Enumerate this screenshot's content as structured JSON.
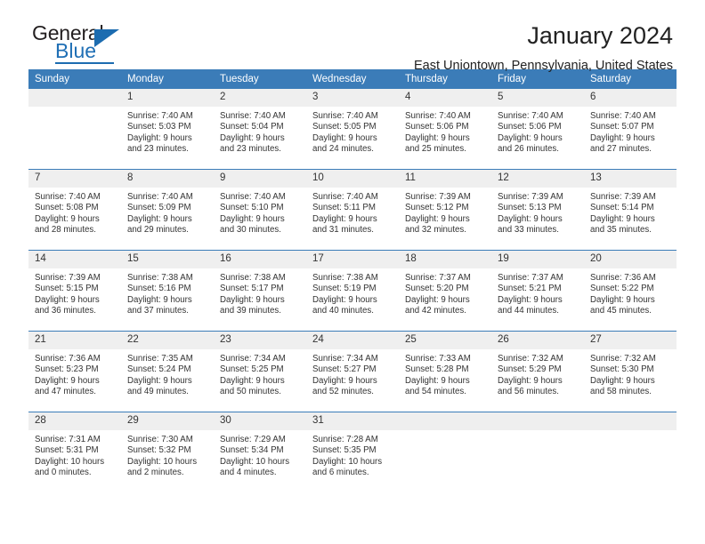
{
  "brand": {
    "name_part1": "General",
    "name_part2": "Blue",
    "accent_color": "#1c6cb0"
  },
  "header": {
    "title": "January 2024",
    "location": "East Uniontown, Pennsylvania, United States"
  },
  "calendar": {
    "header_bg": "#3b7cb8",
    "daynum_bg": "#efefef",
    "weekdays": [
      "Sunday",
      "Monday",
      "Tuesday",
      "Wednesday",
      "Thursday",
      "Friday",
      "Saturday"
    ],
    "weeks": [
      [
        {
          "day": "",
          "sunrise": "",
          "sunset": "",
          "daylight_line1": "",
          "daylight_line2": ""
        },
        {
          "day": "1",
          "sunrise": "Sunrise: 7:40 AM",
          "sunset": "Sunset: 5:03 PM",
          "daylight_line1": "Daylight: 9 hours",
          "daylight_line2": "and 23 minutes."
        },
        {
          "day": "2",
          "sunrise": "Sunrise: 7:40 AM",
          "sunset": "Sunset: 5:04 PM",
          "daylight_line1": "Daylight: 9 hours",
          "daylight_line2": "and 23 minutes."
        },
        {
          "day": "3",
          "sunrise": "Sunrise: 7:40 AM",
          "sunset": "Sunset: 5:05 PM",
          "daylight_line1": "Daylight: 9 hours",
          "daylight_line2": "and 24 minutes."
        },
        {
          "day": "4",
          "sunrise": "Sunrise: 7:40 AM",
          "sunset": "Sunset: 5:06 PM",
          "daylight_line1": "Daylight: 9 hours",
          "daylight_line2": "and 25 minutes."
        },
        {
          "day": "5",
          "sunrise": "Sunrise: 7:40 AM",
          "sunset": "Sunset: 5:06 PM",
          "daylight_line1": "Daylight: 9 hours",
          "daylight_line2": "and 26 minutes."
        },
        {
          "day": "6",
          "sunrise": "Sunrise: 7:40 AM",
          "sunset": "Sunset: 5:07 PM",
          "daylight_line1": "Daylight: 9 hours",
          "daylight_line2": "and 27 minutes."
        }
      ],
      [
        {
          "day": "7",
          "sunrise": "Sunrise: 7:40 AM",
          "sunset": "Sunset: 5:08 PM",
          "daylight_line1": "Daylight: 9 hours",
          "daylight_line2": "and 28 minutes."
        },
        {
          "day": "8",
          "sunrise": "Sunrise: 7:40 AM",
          "sunset": "Sunset: 5:09 PM",
          "daylight_line1": "Daylight: 9 hours",
          "daylight_line2": "and 29 minutes."
        },
        {
          "day": "9",
          "sunrise": "Sunrise: 7:40 AM",
          "sunset": "Sunset: 5:10 PM",
          "daylight_line1": "Daylight: 9 hours",
          "daylight_line2": "and 30 minutes."
        },
        {
          "day": "10",
          "sunrise": "Sunrise: 7:40 AM",
          "sunset": "Sunset: 5:11 PM",
          "daylight_line1": "Daylight: 9 hours",
          "daylight_line2": "and 31 minutes."
        },
        {
          "day": "11",
          "sunrise": "Sunrise: 7:39 AM",
          "sunset": "Sunset: 5:12 PM",
          "daylight_line1": "Daylight: 9 hours",
          "daylight_line2": "and 32 minutes."
        },
        {
          "day": "12",
          "sunrise": "Sunrise: 7:39 AM",
          "sunset": "Sunset: 5:13 PM",
          "daylight_line1": "Daylight: 9 hours",
          "daylight_line2": "and 33 minutes."
        },
        {
          "day": "13",
          "sunrise": "Sunrise: 7:39 AM",
          "sunset": "Sunset: 5:14 PM",
          "daylight_line1": "Daylight: 9 hours",
          "daylight_line2": "and 35 minutes."
        }
      ],
      [
        {
          "day": "14",
          "sunrise": "Sunrise: 7:39 AM",
          "sunset": "Sunset: 5:15 PM",
          "daylight_line1": "Daylight: 9 hours",
          "daylight_line2": "and 36 minutes."
        },
        {
          "day": "15",
          "sunrise": "Sunrise: 7:38 AM",
          "sunset": "Sunset: 5:16 PM",
          "daylight_line1": "Daylight: 9 hours",
          "daylight_line2": "and 37 minutes."
        },
        {
          "day": "16",
          "sunrise": "Sunrise: 7:38 AM",
          "sunset": "Sunset: 5:17 PM",
          "daylight_line1": "Daylight: 9 hours",
          "daylight_line2": "and 39 minutes."
        },
        {
          "day": "17",
          "sunrise": "Sunrise: 7:38 AM",
          "sunset": "Sunset: 5:19 PM",
          "daylight_line1": "Daylight: 9 hours",
          "daylight_line2": "and 40 minutes."
        },
        {
          "day": "18",
          "sunrise": "Sunrise: 7:37 AM",
          "sunset": "Sunset: 5:20 PM",
          "daylight_line1": "Daylight: 9 hours",
          "daylight_line2": "and 42 minutes."
        },
        {
          "day": "19",
          "sunrise": "Sunrise: 7:37 AM",
          "sunset": "Sunset: 5:21 PM",
          "daylight_line1": "Daylight: 9 hours",
          "daylight_line2": "and 44 minutes."
        },
        {
          "day": "20",
          "sunrise": "Sunrise: 7:36 AM",
          "sunset": "Sunset: 5:22 PM",
          "daylight_line1": "Daylight: 9 hours",
          "daylight_line2": "and 45 minutes."
        }
      ],
      [
        {
          "day": "21",
          "sunrise": "Sunrise: 7:36 AM",
          "sunset": "Sunset: 5:23 PM",
          "daylight_line1": "Daylight: 9 hours",
          "daylight_line2": "and 47 minutes."
        },
        {
          "day": "22",
          "sunrise": "Sunrise: 7:35 AM",
          "sunset": "Sunset: 5:24 PM",
          "daylight_line1": "Daylight: 9 hours",
          "daylight_line2": "and 49 minutes."
        },
        {
          "day": "23",
          "sunrise": "Sunrise: 7:34 AM",
          "sunset": "Sunset: 5:25 PM",
          "daylight_line1": "Daylight: 9 hours",
          "daylight_line2": "and 50 minutes."
        },
        {
          "day": "24",
          "sunrise": "Sunrise: 7:34 AM",
          "sunset": "Sunset: 5:27 PM",
          "daylight_line1": "Daylight: 9 hours",
          "daylight_line2": "and 52 minutes."
        },
        {
          "day": "25",
          "sunrise": "Sunrise: 7:33 AM",
          "sunset": "Sunset: 5:28 PM",
          "daylight_line1": "Daylight: 9 hours",
          "daylight_line2": "and 54 minutes."
        },
        {
          "day": "26",
          "sunrise": "Sunrise: 7:32 AM",
          "sunset": "Sunset: 5:29 PM",
          "daylight_line1": "Daylight: 9 hours",
          "daylight_line2": "and 56 minutes."
        },
        {
          "day": "27",
          "sunrise": "Sunrise: 7:32 AM",
          "sunset": "Sunset: 5:30 PM",
          "daylight_line1": "Daylight: 9 hours",
          "daylight_line2": "and 58 minutes."
        }
      ],
      [
        {
          "day": "28",
          "sunrise": "Sunrise: 7:31 AM",
          "sunset": "Sunset: 5:31 PM",
          "daylight_line1": "Daylight: 10 hours",
          "daylight_line2": "and 0 minutes."
        },
        {
          "day": "29",
          "sunrise": "Sunrise: 7:30 AM",
          "sunset": "Sunset: 5:32 PM",
          "daylight_line1": "Daylight: 10 hours",
          "daylight_line2": "and 2 minutes."
        },
        {
          "day": "30",
          "sunrise": "Sunrise: 7:29 AM",
          "sunset": "Sunset: 5:34 PM",
          "daylight_line1": "Daylight: 10 hours",
          "daylight_line2": "and 4 minutes."
        },
        {
          "day": "31",
          "sunrise": "Sunrise: 7:28 AM",
          "sunset": "Sunset: 5:35 PM",
          "daylight_line1": "Daylight: 10 hours",
          "daylight_line2": "and 6 minutes."
        },
        {
          "day": "",
          "sunrise": "",
          "sunset": "",
          "daylight_line1": "",
          "daylight_line2": ""
        },
        {
          "day": "",
          "sunrise": "",
          "sunset": "",
          "daylight_line1": "",
          "daylight_line2": ""
        },
        {
          "day": "",
          "sunrise": "",
          "sunset": "",
          "daylight_line1": "",
          "daylight_line2": ""
        }
      ]
    ]
  }
}
